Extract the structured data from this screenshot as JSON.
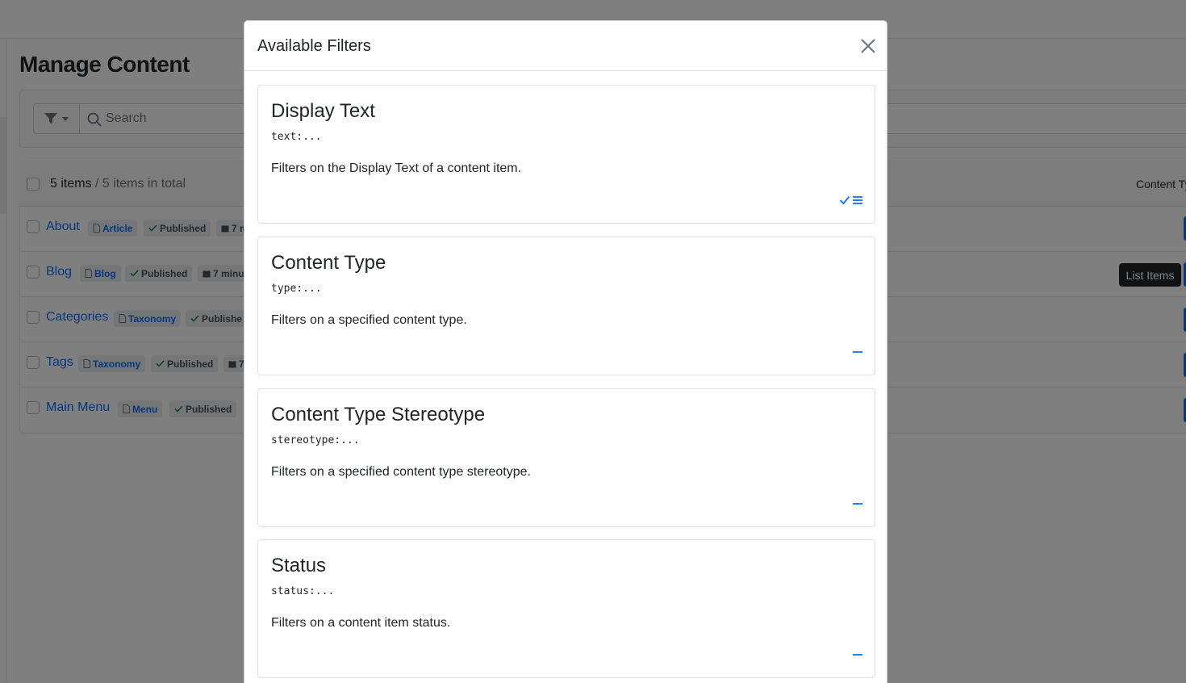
{
  "page": {
    "title": "Manage Content",
    "search_placeholder": "Search",
    "items_count": "5 items",
    "items_total": " / 5 items in total",
    "col_content_type": "Content Ty",
    "tooltip": "List Items"
  },
  "rows": [
    {
      "title": "About",
      "type": "Article",
      "status": "Published",
      "date": "7 m"
    },
    {
      "title": "Blog",
      "type": "Blog",
      "status": "Published",
      "date": "7 minu"
    },
    {
      "title": "Categories",
      "type": "Taxonomy",
      "status": "Publishe",
      "date": ""
    },
    {
      "title": "Tags",
      "type": "Taxonomy",
      "status": "Published",
      "date": "7"
    },
    {
      "title": "Main Menu",
      "type": "Menu",
      "status": "Published",
      "date": ""
    }
  ],
  "modal": {
    "title": "Available Filters",
    "filters": [
      {
        "title": "Display Text",
        "code": "text:...",
        "description": "Filters on the Display Text of a content item.",
        "action_icon": "check-list-icon"
      },
      {
        "title": "Content Type",
        "code": "type:...",
        "description": "Filters on a specified content type.",
        "action_icon": "minus-icon"
      },
      {
        "title": "Content Type Stereotype",
        "code": "stereotype:...",
        "description": "Filters on a specified content type stereotype.",
        "action_icon": "minus-icon"
      },
      {
        "title": "Status",
        "code": "status:...",
        "description": "Filters on a content item status.",
        "action_icon": "minus-icon"
      }
    ]
  },
  "colors": {
    "accent": "#0d6efd",
    "backdrop": "rgba(0,0,0,0.5)"
  }
}
